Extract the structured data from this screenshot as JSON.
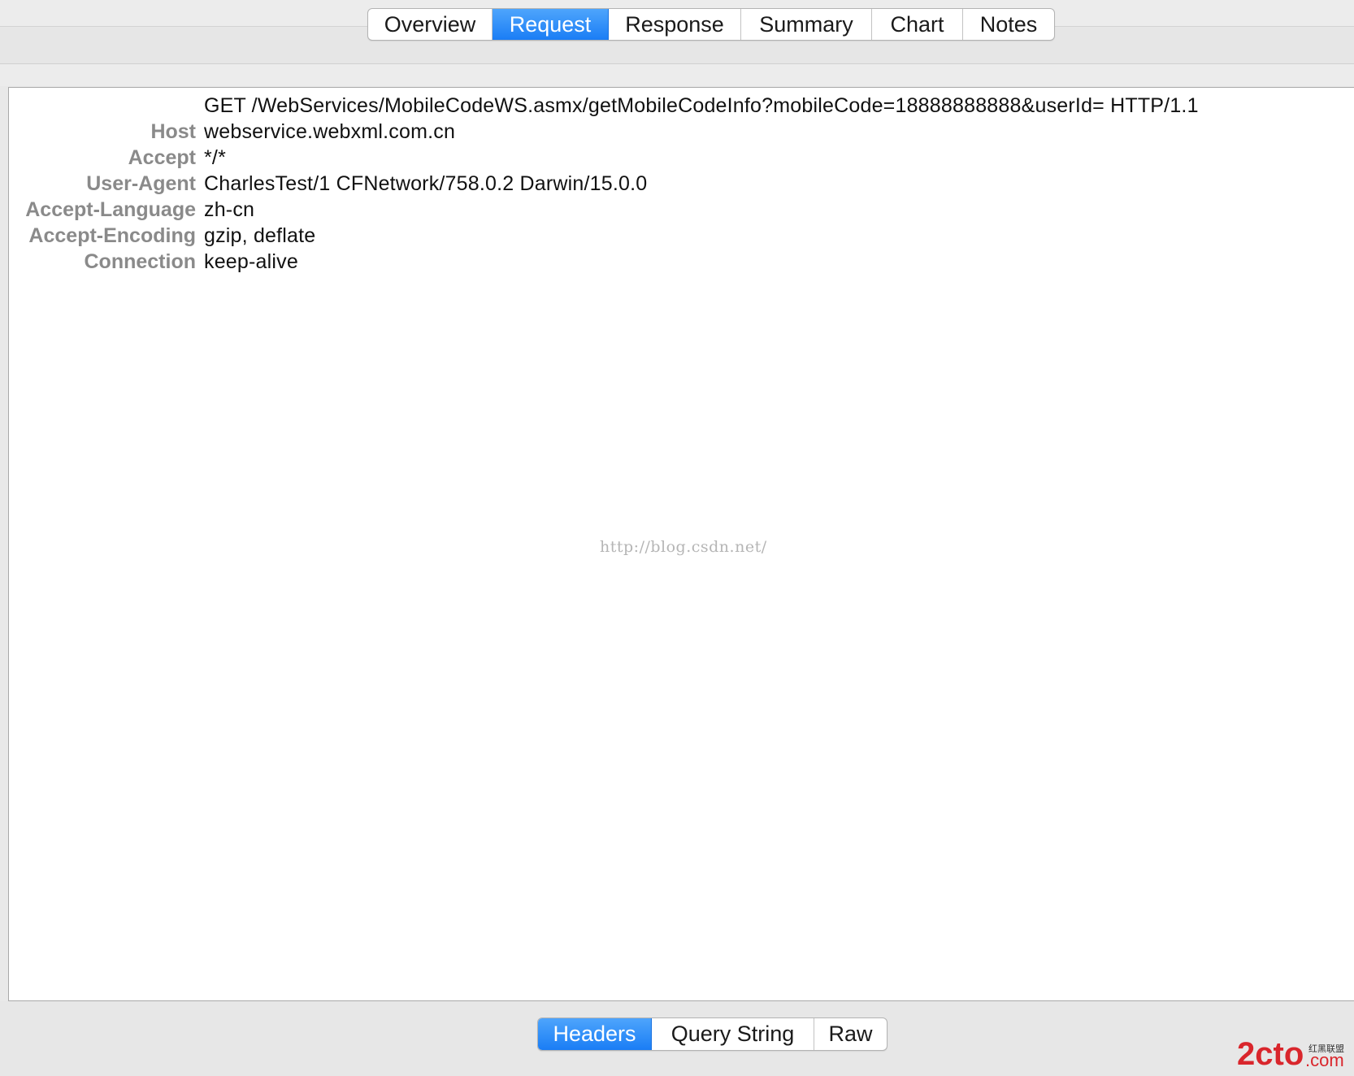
{
  "top_tabs": [
    {
      "label": "Overview",
      "active": false
    },
    {
      "label": "Request",
      "active": true
    },
    {
      "label": "Response",
      "active": false
    },
    {
      "label": "Summary",
      "active": false
    },
    {
      "label": "Chart",
      "active": false
    },
    {
      "label": "Notes",
      "active": false
    }
  ],
  "request": {
    "request_line": "GET /WebServices/MobileCodeWS.asmx/getMobileCodeInfo?mobileCode=18888888888&userId= HTTP/1.1",
    "headers": [
      {
        "name": "Host",
        "value": "webservice.webxml.com.cn"
      },
      {
        "name": "Accept",
        "value": "*/*"
      },
      {
        "name": "User-Agent",
        "value": "CharlesTest/1 CFNetwork/758.0.2 Darwin/15.0.0"
      },
      {
        "name": "Accept-Language",
        "value": "zh-cn"
      },
      {
        "name": "Accept-Encoding",
        "value": "gzip, deflate"
      },
      {
        "name": "Connection",
        "value": "keep-alive"
      }
    ]
  },
  "watermark": "http://blog.csdn.net/",
  "bottom_tabs": [
    {
      "label": "Headers",
      "active": true
    },
    {
      "label": "Query String",
      "active": false
    },
    {
      "label": "Raw",
      "active": false
    }
  ],
  "corner_logo": {
    "main": "2cto",
    "suffix": ".com",
    "tagline": "红黑联盟"
  },
  "colors": {
    "accent_blue": "#1a7df5",
    "header_name_gray": "#8a8a8a",
    "logo_red": "#d9262c"
  }
}
